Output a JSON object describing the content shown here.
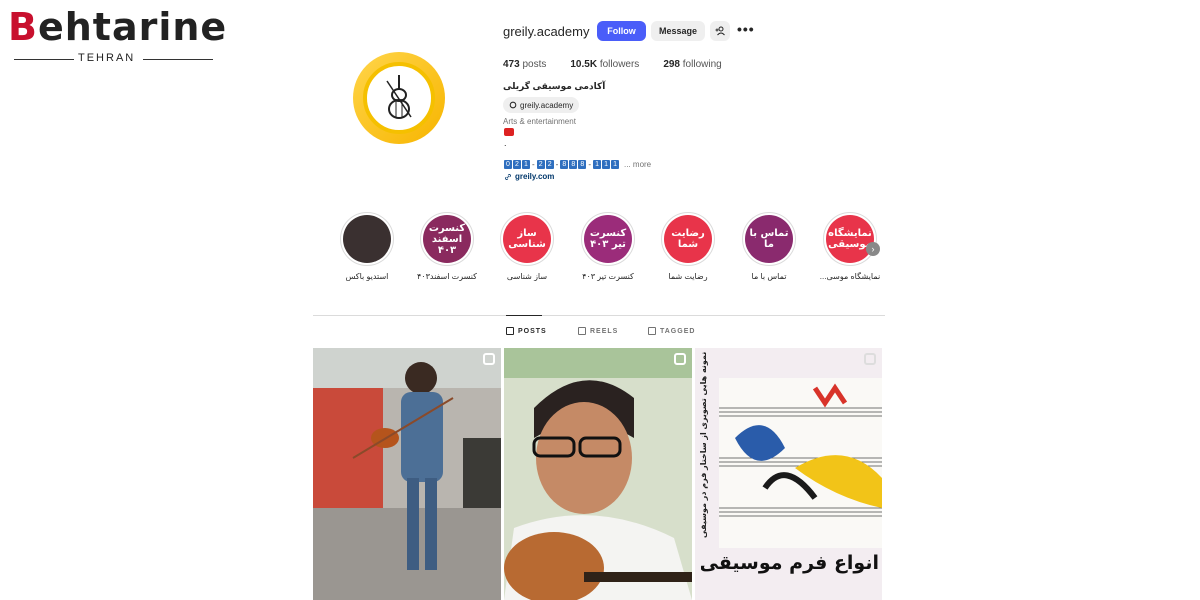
{
  "watermark": {
    "brand": "ehtarine",
    "brand_initial": "B",
    "city": "TEHRAN"
  },
  "profile": {
    "username": "greily.academy",
    "follow_label": "Follow",
    "message_label": "Message",
    "posts_count": "473",
    "posts_label": "posts",
    "followers_count": "10.5K",
    "followers_label": "followers",
    "following_count": "298",
    "following_label": "following",
    "full_name": "آکادمی موسیقی گریلی",
    "threads_handle": "greily.academy",
    "category": "Arts & entertainment",
    "bio_line1": ".",
    "bio_line2": "",
    "phone_digits": [
      "0",
      "2",
      "1",
      "-",
      "2",
      "2",
      "-",
      "8",
      "8",
      "8",
      "-",
      "1",
      "1",
      "1"
    ],
    "more_label": "... more",
    "website": "greily.com"
  },
  "highlights": [
    {
      "label": "استدیو باکس",
      "text": "",
      "color": "#3a3030"
    },
    {
      "label": "کنسرت اسفند۴۰۳",
      "text": "کنسرت اسفند ۴۰۳",
      "color": "#8a2a5e"
    },
    {
      "label": "ساز شناسی",
      "text": "ساز شناسی",
      "color": "#e8344a"
    },
    {
      "label": "کنسرت تیر ۴۰۳",
      "text": "کنسرت تیر ۴۰۳",
      "color": "#9b2c7a"
    },
    {
      "label": "رضایت شما",
      "text": "رضایت شما",
      "color": "#e8344a"
    },
    {
      "label": "تماس با ما",
      "text": "تماس با ما",
      "color": "#8a2a6e"
    },
    {
      "label": "نمایشگاه موسی...",
      "text": "نمایشگاه موسیقی",
      "color": "#e8344a"
    }
  ],
  "tabs": [
    {
      "label": "POSTS",
      "active": true
    },
    {
      "label": "REELS",
      "active": false
    },
    {
      "label": "TAGGED",
      "active": false
    }
  ],
  "posts": [
    {
      "type": "reel",
      "caption": ""
    },
    {
      "type": "reel",
      "caption": ""
    },
    {
      "type": "carousel",
      "side_text": "نمونه هایی تصویری از ساختار فرم در موسیقی",
      "caption": "انواع فرم موسیقی"
    }
  ]
}
